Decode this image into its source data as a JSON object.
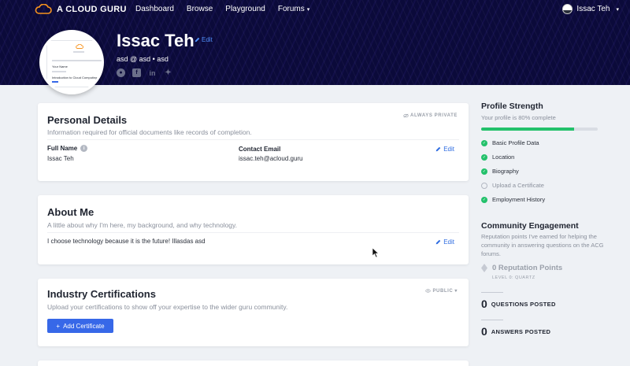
{
  "brand": {
    "name": "A CLOUD GURU",
    "accent": "#f7931e"
  },
  "nav": {
    "links": [
      "Dashboard",
      "Browse",
      "Playground",
      "Forums"
    ],
    "forums_caret": "▾",
    "user_name": "Issac Teh",
    "user_caret": "▾"
  },
  "profile": {
    "name": "Issac Teh",
    "edit_label": "Edit",
    "subtitle": "asd @ asd • asd",
    "socials": [
      "github-icon",
      "facebook-icon",
      "linkedin-icon",
      "twitter-icon"
    ],
    "certificate_preview": {
      "name_line": "Your Name",
      "course_line": "Introduction to Cloud Computing"
    }
  },
  "personal_details": {
    "title": "Personal Details",
    "badge": "ALWAYS PRIVATE",
    "description": "Information required for official documents like records of completion.",
    "full_name_label": "Full Name",
    "full_name_value": "Issac Teh",
    "contact_email_label": "Contact Email",
    "contact_email_value": "issac.teh@acloud.guru",
    "edit_label": "Edit"
  },
  "about_me": {
    "title": "About Me",
    "description": "A little about why I'm here, my background, and why technology.",
    "text": "I choose technology because it is the future! Illasdas asd",
    "edit_label": "Edit"
  },
  "certifications": {
    "title": "Industry Certifications",
    "badge": "PUBLIC",
    "badge_caret": "▾",
    "description": "Upload your certifications to show off your expertise to the wider guru community.",
    "button_label": "Add Certificate"
  },
  "profile_strength": {
    "title": "Profile Strength",
    "subtitle": "Your profile is 80% complete",
    "percent_complete": 80,
    "items": [
      {
        "label": "Basic Profile Data",
        "done": true
      },
      {
        "label": "Location",
        "done": true
      },
      {
        "label": "Biography",
        "done": true
      },
      {
        "label": "Upload a Certificate",
        "done": false
      },
      {
        "label": "Employment History",
        "done": true
      }
    ]
  },
  "community": {
    "title": "Community Engagement",
    "description": "Reputation points I've earned for helping the community in answering questions on the ACG forums.",
    "reputation": "0 Reputation Points",
    "level": "LEVEL 0: QUARTZ",
    "questions_num": "0",
    "questions_label": "QUESTIONS POSTED",
    "answers_num": "0",
    "answers_label": "ANSWERS POSTED"
  },
  "colors": {
    "hero_bg": "#0b0a3a",
    "primary": "#3768e8",
    "success": "#23c16b",
    "link": "#2f6de1"
  }
}
